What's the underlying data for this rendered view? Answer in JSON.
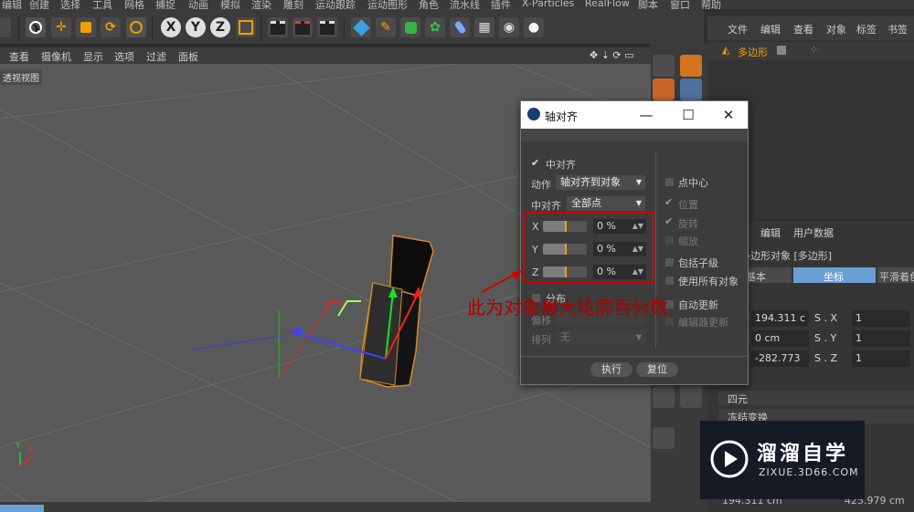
{
  "menubar": [
    "编辑",
    "创建",
    "选择",
    "工具",
    "网格",
    "捕捉",
    "动画",
    "模拟",
    "渲染",
    "雕刻",
    "运动跟踪",
    "运动图形",
    "角色",
    "流水线",
    "插件",
    "X-Particles",
    "RealFlow",
    "脚本",
    "窗口",
    "帮助"
  ],
  "toolbar": {
    "x_label": "X",
    "y_label": "Y",
    "z_label": "Z"
  },
  "viewport": {
    "menu": [
      "查看",
      "摄像机",
      "显示",
      "选项",
      "过滤",
      "面板"
    ],
    "label": "透视视图",
    "axis_y": "Y",
    "axis_x": "X"
  },
  "object_manager": {
    "menu": [
      "文件",
      "编辑",
      "查看",
      "对象",
      "标签",
      "书签"
    ],
    "object_name": "多边形"
  },
  "attribute_manager": {
    "menu": [
      "编辑",
      "用户数据"
    ],
    "title": "多边形对象 [多边形]",
    "tabs": [
      "基本",
      "坐标",
      "平滑着色"
    ],
    "rows": [
      {
        "p": "194.311 c",
        "s_label": "S . X",
        "s": "1"
      },
      {
        "p": "0 cm",
        "s_label": "S . Y",
        "s": "1"
      },
      {
        "p": "-282.773",
        "s_label": "S . Z",
        "s": "1"
      }
    ],
    "section_quat": "四元",
    "section_freeze": "冻结变换"
  },
  "bottom": {
    "coord_value": "194.311 cm",
    "coord_value2": "425.979 cm"
  },
  "dialog": {
    "title": "轴对齐",
    "center_align": "中对齐",
    "action_label": "动作",
    "action_value": "轴对齐到对象",
    "center_label": "中对齐",
    "center_value": "全部点",
    "axes": [
      {
        "label": "X",
        "value": "0 %",
        "fraction": 0.5
      },
      {
        "label": "Y",
        "value": "0 %",
        "fraction": 0.5
      },
      {
        "label": "Z",
        "value": "0 %",
        "fraction": 0.5
      }
    ],
    "point_center": "点中心",
    "position": "位置",
    "rotation": "旋转",
    "scale": "缩放",
    "include_children": "包括子级",
    "use_all_objects": "使用所有对象",
    "auto_update": "自动更新",
    "editor_update": "编辑器更新",
    "distribute": "分布",
    "offset_label": "偏移",
    "arrange_label": "排列",
    "arrange_value": "无",
    "execute": "执行",
    "reset": "复位"
  },
  "annotation": "此为对象最大轮廓百分数",
  "watermark": {
    "name": "溜溜自学",
    "url": "ZIXUE.3D66.COM"
  },
  "colors": {
    "accent": "#f0a000",
    "highlight_tab": "#6b9fd4",
    "red": "#d00000"
  }
}
